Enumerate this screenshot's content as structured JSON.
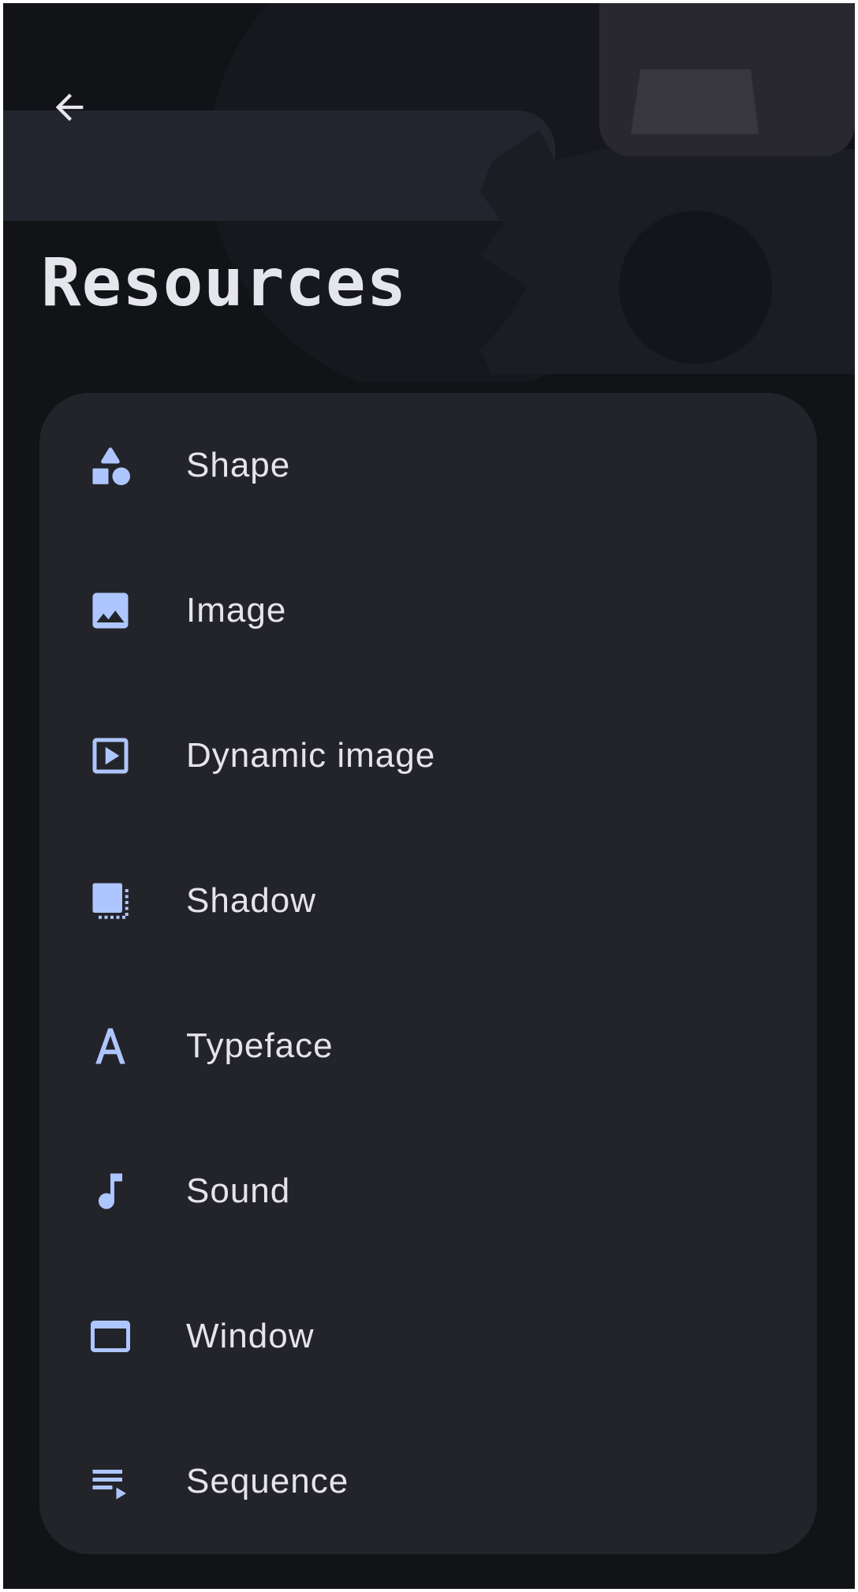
{
  "app": {
    "title": "Resources"
  },
  "header": {
    "back_icon": "arrow-back-icon"
  },
  "colors": {
    "background": "#121317",
    "card": "#23242a",
    "icon_accent": "#aec6ff",
    "text": "#e4e4ea"
  },
  "resources": {
    "items": [
      {
        "label": "Shape",
        "icon": "shapes-icon"
      },
      {
        "label": "Image",
        "icon": "image-icon"
      },
      {
        "label": "Dynamic image",
        "icon": "play-box-icon"
      },
      {
        "label": "Shadow",
        "icon": "shadow-icon"
      },
      {
        "label": "Typeface",
        "icon": "typeface-icon"
      },
      {
        "label": "Sound",
        "icon": "music-note-icon"
      },
      {
        "label": "Window",
        "icon": "window-icon"
      },
      {
        "label": "Sequence",
        "icon": "playlist-play-icon"
      }
    ]
  }
}
